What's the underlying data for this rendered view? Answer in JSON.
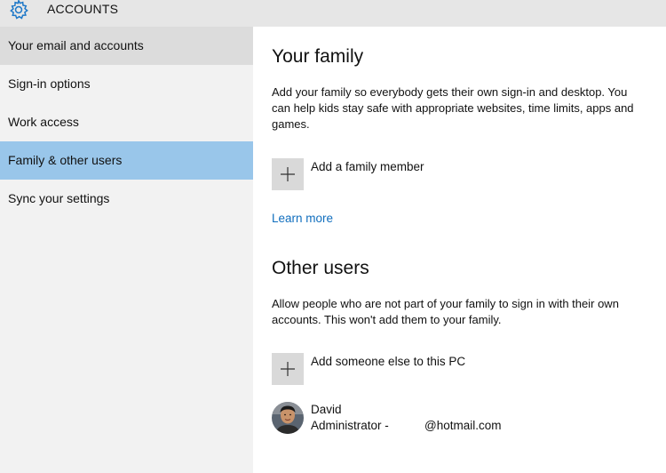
{
  "header": {
    "title": "ACCOUNTS",
    "icon": "gear-icon",
    "accent": "#1e78c8"
  },
  "sidebar": {
    "items": [
      {
        "label": "Your email and accounts",
        "state": "hover"
      },
      {
        "label": "Sign-in options",
        "state": "normal"
      },
      {
        "label": "Work access",
        "state": "normal"
      },
      {
        "label": "Family & other users",
        "state": "selected"
      },
      {
        "label": "Sync your settings",
        "state": "normal"
      }
    ],
    "selected_color": "#99c6ea"
  },
  "family": {
    "heading": "Your family",
    "description": "Add your family so everybody gets their own sign-in and desktop. You can help kids stay safe with appropriate websites, time limits, apps and games.",
    "add_label": "Add a family member",
    "add_icon": "plus-icon",
    "learn_more": "Learn more"
  },
  "other_users": {
    "heading": "Other users",
    "description": "Allow people who are not part of your family to sign in with their own accounts. This won't add them to your family.",
    "add_label": "Add someone else to this PC",
    "add_icon": "plus-icon",
    "users": [
      {
        "name": "David",
        "role": "Administrator -",
        "email": "@hotmail.com",
        "avatar_icon": "user-avatar"
      }
    ]
  },
  "colors": {
    "link": "#106ebe",
    "header_bg": "#e6e6e6",
    "sidebar_bg": "#f2f2f2",
    "tile_bg": "#d9d9d9"
  }
}
